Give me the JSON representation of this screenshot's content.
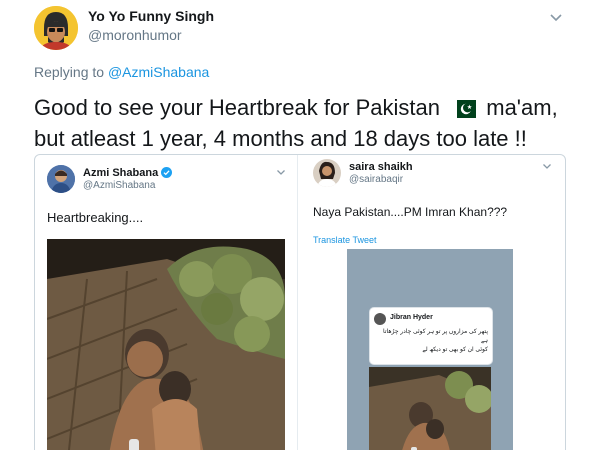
{
  "tweet": {
    "display_name": "Yo Yo Funny Singh",
    "handle": "@moronhumor",
    "reply_prefix": "Replying to",
    "reply_mention": "@AzmiShabana",
    "text_line1_a": "Good to see your Heartbreak for Pakistan",
    "text_line1_b": "ma'am,",
    "text_line2": "but atleast 1 year, 4 months and 18 days too late !!",
    "flag_icon": "pakistan-flag-icon",
    "caret_icon": "chevron-down-icon"
  },
  "left_embed": {
    "display_name": "Azmi Shabana",
    "handle": "@AzmiShabana",
    "text": "Heartbreaking....",
    "verified_icon": "verified-badge-icon"
  },
  "right_embed": {
    "display_name": "saira shaikh",
    "handle": "@sairabaqir",
    "text": "Naya Pakistan....PM Imran Khan???",
    "translate_label": "Translate Tweet",
    "inner_card": {
      "name": "Jibran Hyder",
      "urdu_line1": "پتھر کی مزاروں پر تو ہر کوئی چادر چڑھاتا",
      "urdu_line2": "ہے",
      "urdu_line3": "کوئی ان کو بھی تو دیکھ لے"
    }
  },
  "colors": {
    "link": "#1b95e0",
    "secondary_text": "#657786",
    "verified": "#1da1f2",
    "flag_green": "#01411c",
    "avatar_yellow": "#f4c430"
  }
}
